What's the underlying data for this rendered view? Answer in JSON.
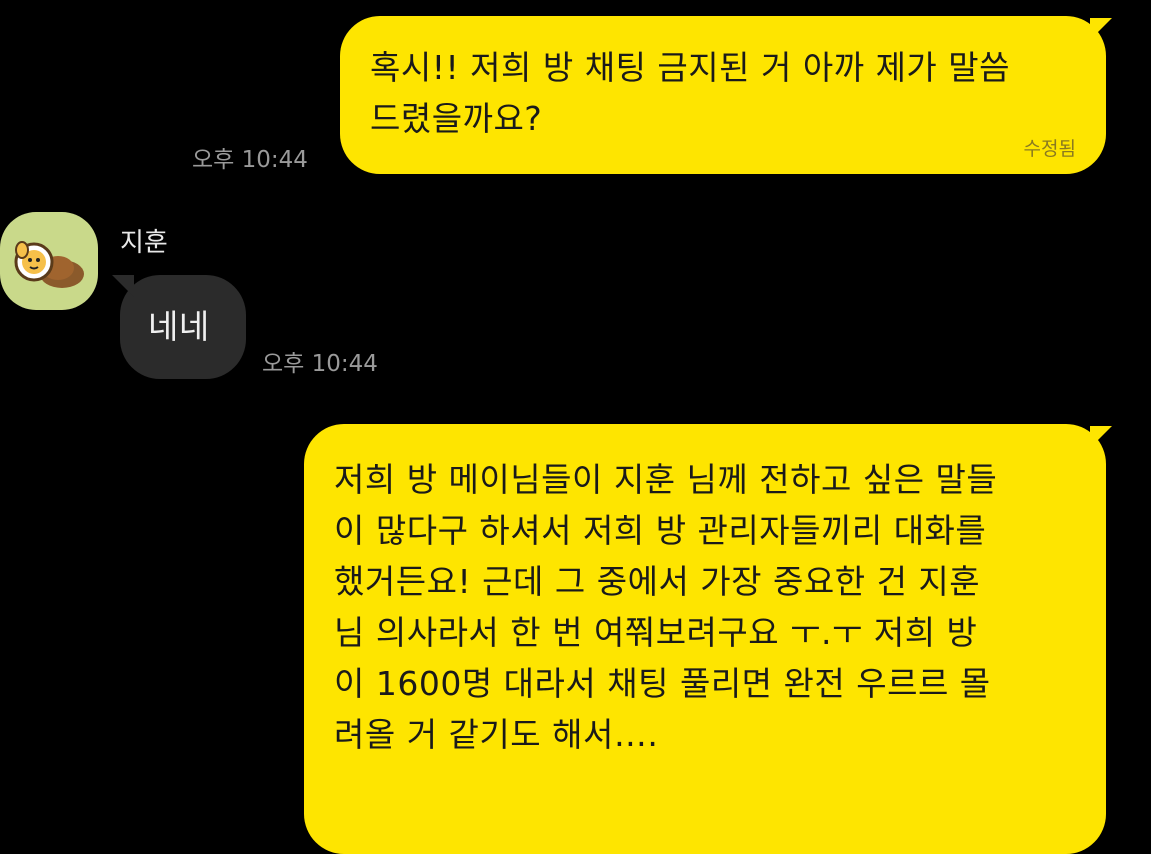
{
  "messages": [
    {
      "side": "me",
      "text": "혹시!! 저희 방 채팅 금지된 거 아까 제가 말씀\n드렸을까요?",
      "edited": "수정됨",
      "time": "오후 10:44"
    },
    {
      "side": "other",
      "sender": "지훈",
      "text": "네네",
      "time": "오후 10:44"
    },
    {
      "side": "me",
      "text": "저희 방 메이님들이 지훈 님께 전하고 싶은 말들\n이 많다구 하셔서 저희 방 관리자들끼리 대화를\n했거든요! 근데 그 중에서 가장 중요한 건 지훈\n님 의사라서 한 번 여쭤보려구요 ㅜ.ㅜ 저희 방\n이 1600명 대라서 채팅 풀리면 완전 우르르 몰\n려올 거 같기도 해서….",
      "time": ""
    }
  ],
  "colors": {
    "my_bubble": "#FEE500",
    "other_bubble": "#2b2b2b",
    "background": "#000000"
  },
  "avatar_icon": "dog-character-icon"
}
